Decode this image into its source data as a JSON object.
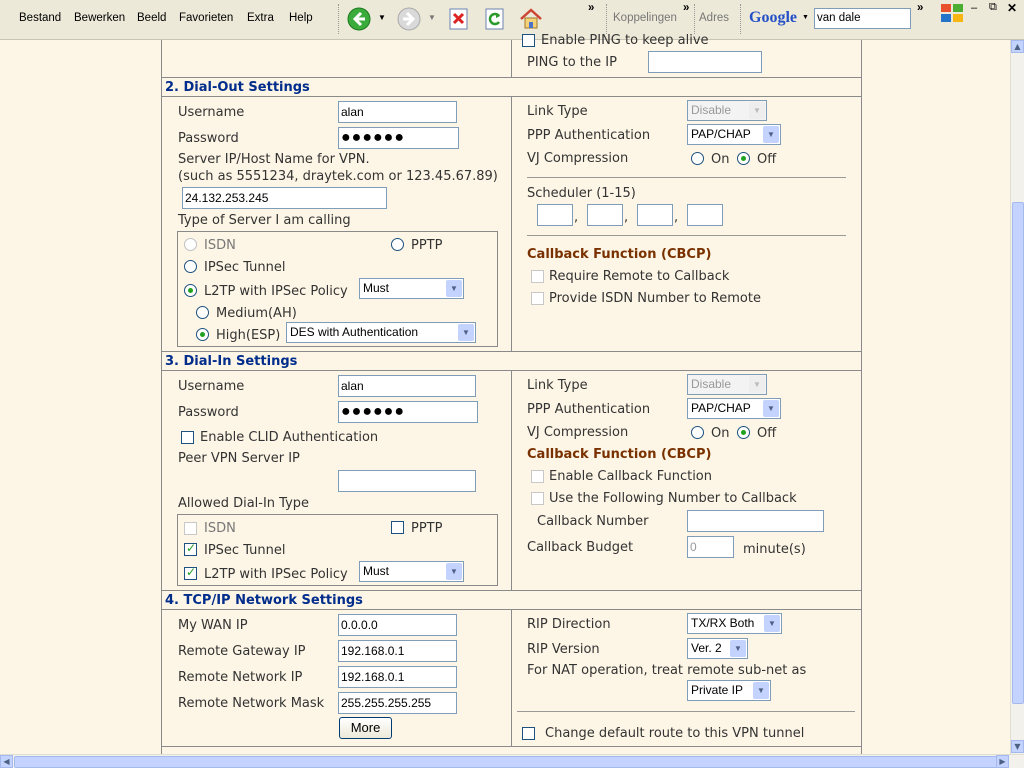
{
  "menu": [
    "Bestand",
    "Bewerken",
    "Beeld",
    "Favorieten",
    "Extra",
    "Help"
  ],
  "toolbar": {
    "links_label": "Koppelingen",
    "address_label": "Adres",
    "chevron": "»",
    "google_label": "Google",
    "search_value": "van dale",
    "icons": [
      "back-icon",
      "forward-icon",
      "stop-icon",
      "refresh-icon",
      "home-icon",
      "windows-logo-icon"
    ]
  },
  "top_partial": {
    "ping_keep_alive": "Enable PING to keep alive",
    "ping_ip_label": "PING to the IP",
    "ping_ip_value": ""
  },
  "dialout": {
    "title": "2. Dial-Out Settings",
    "username_label": "Username",
    "username": "alan",
    "password_label": "Password",
    "password": "●●●●●●",
    "server_label": "Server IP/Host Name for VPN.",
    "server_hint": "(such as 5551234, draytek.com or 123.45.67.89)",
    "server_value": "24.132.253.245",
    "type_label": "Type of Server I am calling",
    "isdn": "ISDN",
    "pptp": "PPTP",
    "ipsec": "IPSec Tunnel",
    "l2tp": "L2TP with IPSec Policy",
    "l2tp_policy": "Must",
    "medium": "Medium(AH)",
    "high": "High(ESP)",
    "high_value": "DES with Authentication",
    "link_type_label": "Link Type",
    "link_type": "Disable",
    "ppp_auth_label": "PPP Authentication",
    "ppp_auth": "PAP/CHAP",
    "vj_label": "VJ Compression",
    "on": "On",
    "off": "Off",
    "scheduler_label": "Scheduler (1-15)",
    "sched_sep": ",",
    "cbcp_title": "Callback Function (CBCP)",
    "require_remote": "Require Remote to Callback",
    "provide_isdn": "Provide ISDN Number to Remote"
  },
  "dialin": {
    "title": "3. Dial-In Settings",
    "username_label": "Username",
    "username": "alan",
    "password_label": "Password",
    "password": "●●●●●●",
    "clid": "Enable CLID Authentication",
    "peer_label": "Peer VPN Server IP",
    "peer_value": "",
    "allowed_label": "Allowed Dial-In Type",
    "isdn": "ISDN",
    "pptp": "PPTP",
    "ipsec": "IPSec Tunnel",
    "l2tp": "L2TP with IPSec Policy",
    "l2tp_policy": "Must",
    "link_type_label": "Link Type",
    "link_type": "Disable",
    "ppp_auth_label": "PPP Authentication",
    "ppp_auth": "PAP/CHAP",
    "vj_label": "VJ Compression",
    "on": "On",
    "off": "Off",
    "cbcp_title": "Callback Function (CBCP)",
    "enable_callback": "Enable Callback Function",
    "use_following": "Use the Following Number to Callback",
    "callback_number_label": "Callback Number",
    "callback_number": "",
    "callback_budget_label": "Callback Budget",
    "callback_budget": "0",
    "minutes": "minute(s)"
  },
  "tcpip": {
    "title": "4. TCP/IP Network Settings",
    "wan_label": "My WAN IP",
    "wan": "0.0.0.0",
    "gw_label": "Remote Gateway IP",
    "gw": "192.168.0.1",
    "net_label": "Remote Network IP",
    "net": "192.168.0.1",
    "mask_label": "Remote Network Mask",
    "mask": "255.255.255.255",
    "more_button": "More",
    "rip_dir_label": "RIP Direction",
    "rip_dir": "TX/RX Both",
    "rip_ver_label": "RIP Version",
    "rip_ver": "Ver. 2",
    "nat_label": "For NAT operation, treat remote sub-net as",
    "nat_value": "Private IP",
    "default_route": "Change default route to this VPN tunnel"
  }
}
